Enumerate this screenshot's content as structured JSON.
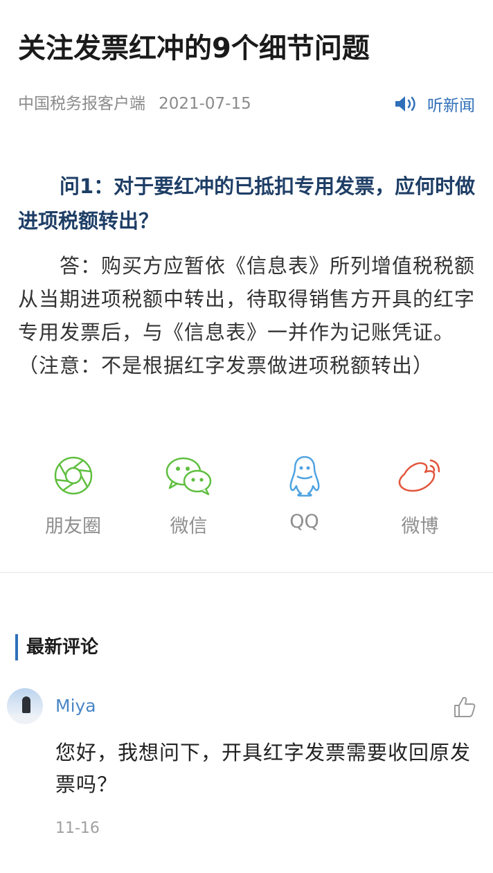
{
  "article": {
    "title": "关注发票红冲的9个细节问题",
    "source": "中国税务报客户端",
    "date": "2021-07-15",
    "listen_label": "听新闻",
    "question": "问1：对于要红冲的已抵扣专用发票，应何时做进项税额转出？",
    "answer": "答：购买方应暂依《信息表》所列增值税税额从当期进项税额中转出，待取得销售方开具的红字专用发票后，与《信息表》一并作为记账凭证。（注意：不是根据红字发票做进项税额转出）"
  },
  "share": [
    {
      "label": "朋友圈",
      "icon": "moments-icon",
      "color": "#5fbf3f"
    },
    {
      "label": "微信",
      "icon": "wechat-icon",
      "color": "#5fbf3f"
    },
    {
      "label": "QQ",
      "icon": "qq-icon",
      "color": "#4fa3e0"
    },
    {
      "label": "微博",
      "icon": "weibo-icon",
      "color": "#e2553b"
    }
  ],
  "comments_section": {
    "heading": "最新评论",
    "items": [
      {
        "user": "Miya",
        "text": "您好，我想问下，开具红字发票需要收回原发票吗？",
        "time": "11-16"
      }
    ]
  },
  "colors": {
    "accent": "#2f6fb9",
    "question": "#1e3e66",
    "username": "#4a86c6"
  }
}
